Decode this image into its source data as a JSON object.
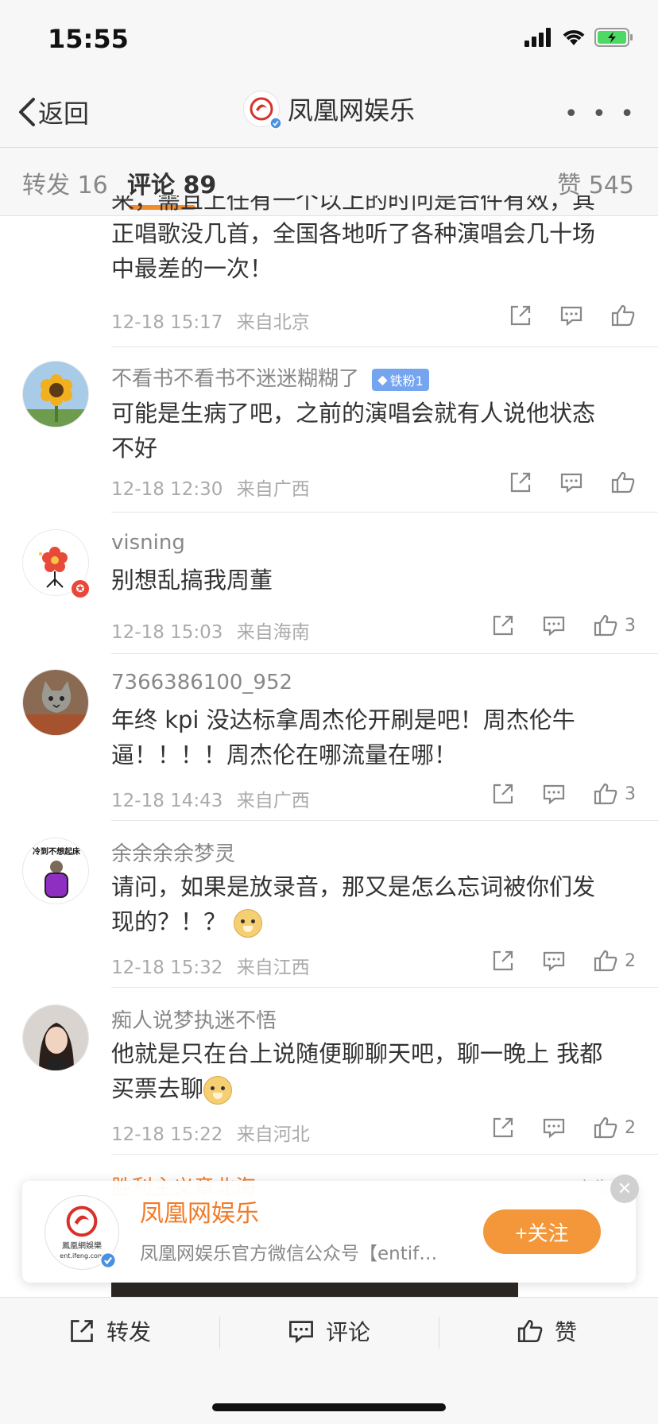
{
  "status_bar": {
    "time": "15:55"
  },
  "nav": {
    "back_label": "返回",
    "title": "凤凰网娱乐"
  },
  "tabs": {
    "repost": "转发 16",
    "comment": "评论 89",
    "like": "赞 545"
  },
  "comments": [
    {
      "text_lines": [
        "来，需且上任有一个以上的时问是合件有效，其",
        "正唱歌没几首，全国各地听了各种演唱会几十场",
        "中最差的一次！"
      ],
      "time": "12-18 15:17",
      "location": "来自北京",
      "likes": ""
    },
    {
      "name": "不看书不看书不迷迷糊糊了",
      "badge": "铁粉1",
      "text_lines": [
        "可能是生病了吧，之前的演唱会就有人说他状态",
        "不好"
      ],
      "time": "12-18 12:30",
      "location": "来自广西",
      "likes": ""
    },
    {
      "name": "visning",
      "text_lines": [
        "别想乱搞我周董"
      ],
      "time": "12-18 15:03",
      "location": "来自海南",
      "likes": "3"
    },
    {
      "name": "7366386100_952",
      "text_lines": [
        "年终 kpi 没达标拿周杰伦开刷是吧！周杰伦牛",
        "逼！！！！周杰伦在哪流量在哪！"
      ],
      "time": "12-18 14:43",
      "location": "来自广西",
      "likes": "3"
    },
    {
      "name": "余余余余梦灵",
      "avatar_caption": "冷到不想起床",
      "text_lines": [
        "请问，如果是放录音，那又是怎么忘词被你们发",
        "现的？！？"
      ],
      "time": "12-18 15:32",
      "location": "来自江西",
      "likes": "2"
    },
    {
      "name": "痴人说梦执迷不悟",
      "text_lines": [
        "他就是只在台上说随便聊聊天吧，聊一晚上 我都",
        "买票去聊"
      ],
      "time": "12-18 15:22",
      "location": "来自河北",
      "likes": "2"
    }
  ],
  "ad_row": {
    "name": "胜利主义章北海",
    "label": "广告"
  },
  "follow_card": {
    "name": "凤凰网娱乐",
    "description": "凤凰网娱乐官方微信公众号【entife...",
    "follow_label": "+关注",
    "logo_text": "鳳凰網娛樂",
    "logo_url_text": "ent.ifeng.com"
  },
  "bottom_bar": {
    "repost": "转发",
    "comment": "评论",
    "like": "赞"
  },
  "colors": {
    "accent": "#f28b2c",
    "follow_button": "#f3973a",
    "fans_badge": "#76a5ef"
  },
  "icons": [
    "back-chevron-icon",
    "signal-icon",
    "wifi-icon",
    "battery-icon",
    "verified-icon",
    "more-icon",
    "share-icon",
    "comment-icon",
    "like-icon",
    "close-icon"
  ]
}
